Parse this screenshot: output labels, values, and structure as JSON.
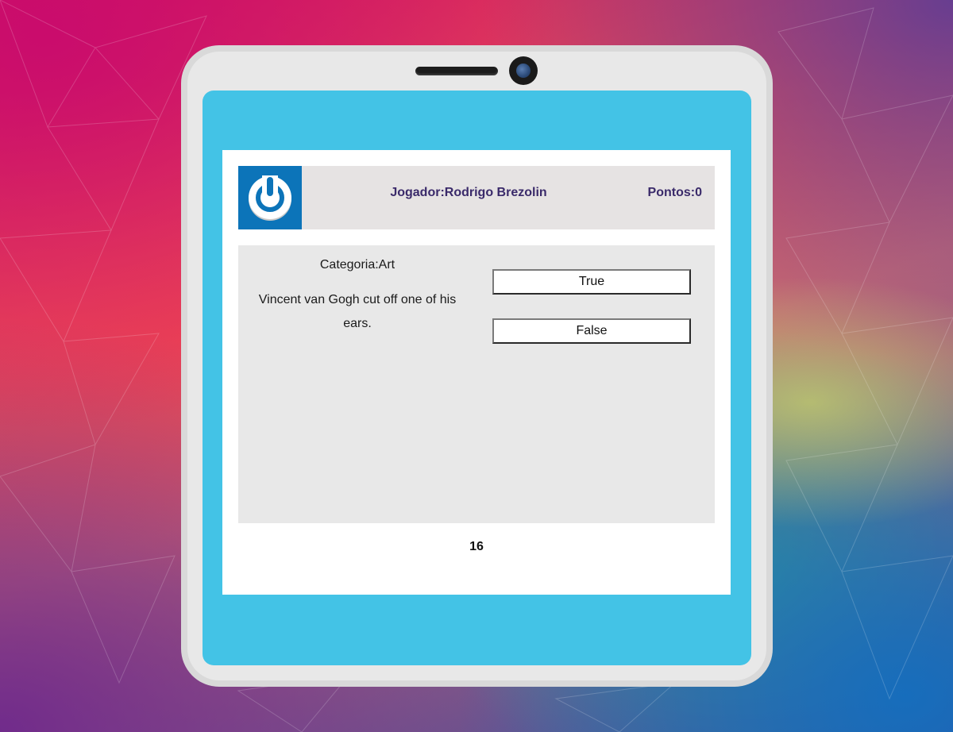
{
  "header": {
    "player_text": "Jogador:Rodrigo Brezolin",
    "points_text": "Pontos:0"
  },
  "question": {
    "category_text": "Categoria:Art",
    "text": "Vincent van Gogh cut off one of his ears."
  },
  "answers": {
    "true_label": "True",
    "false_label": "False"
  },
  "timer": {
    "value": "16"
  },
  "colors": {
    "screen": "#43c3e6",
    "logo_background": "#0c74b9",
    "header_background": "#e6e3e3",
    "header_text": "#3a2a6a",
    "panel_background": "#e8e8e8"
  },
  "icons": {
    "logo": "power-icon"
  }
}
